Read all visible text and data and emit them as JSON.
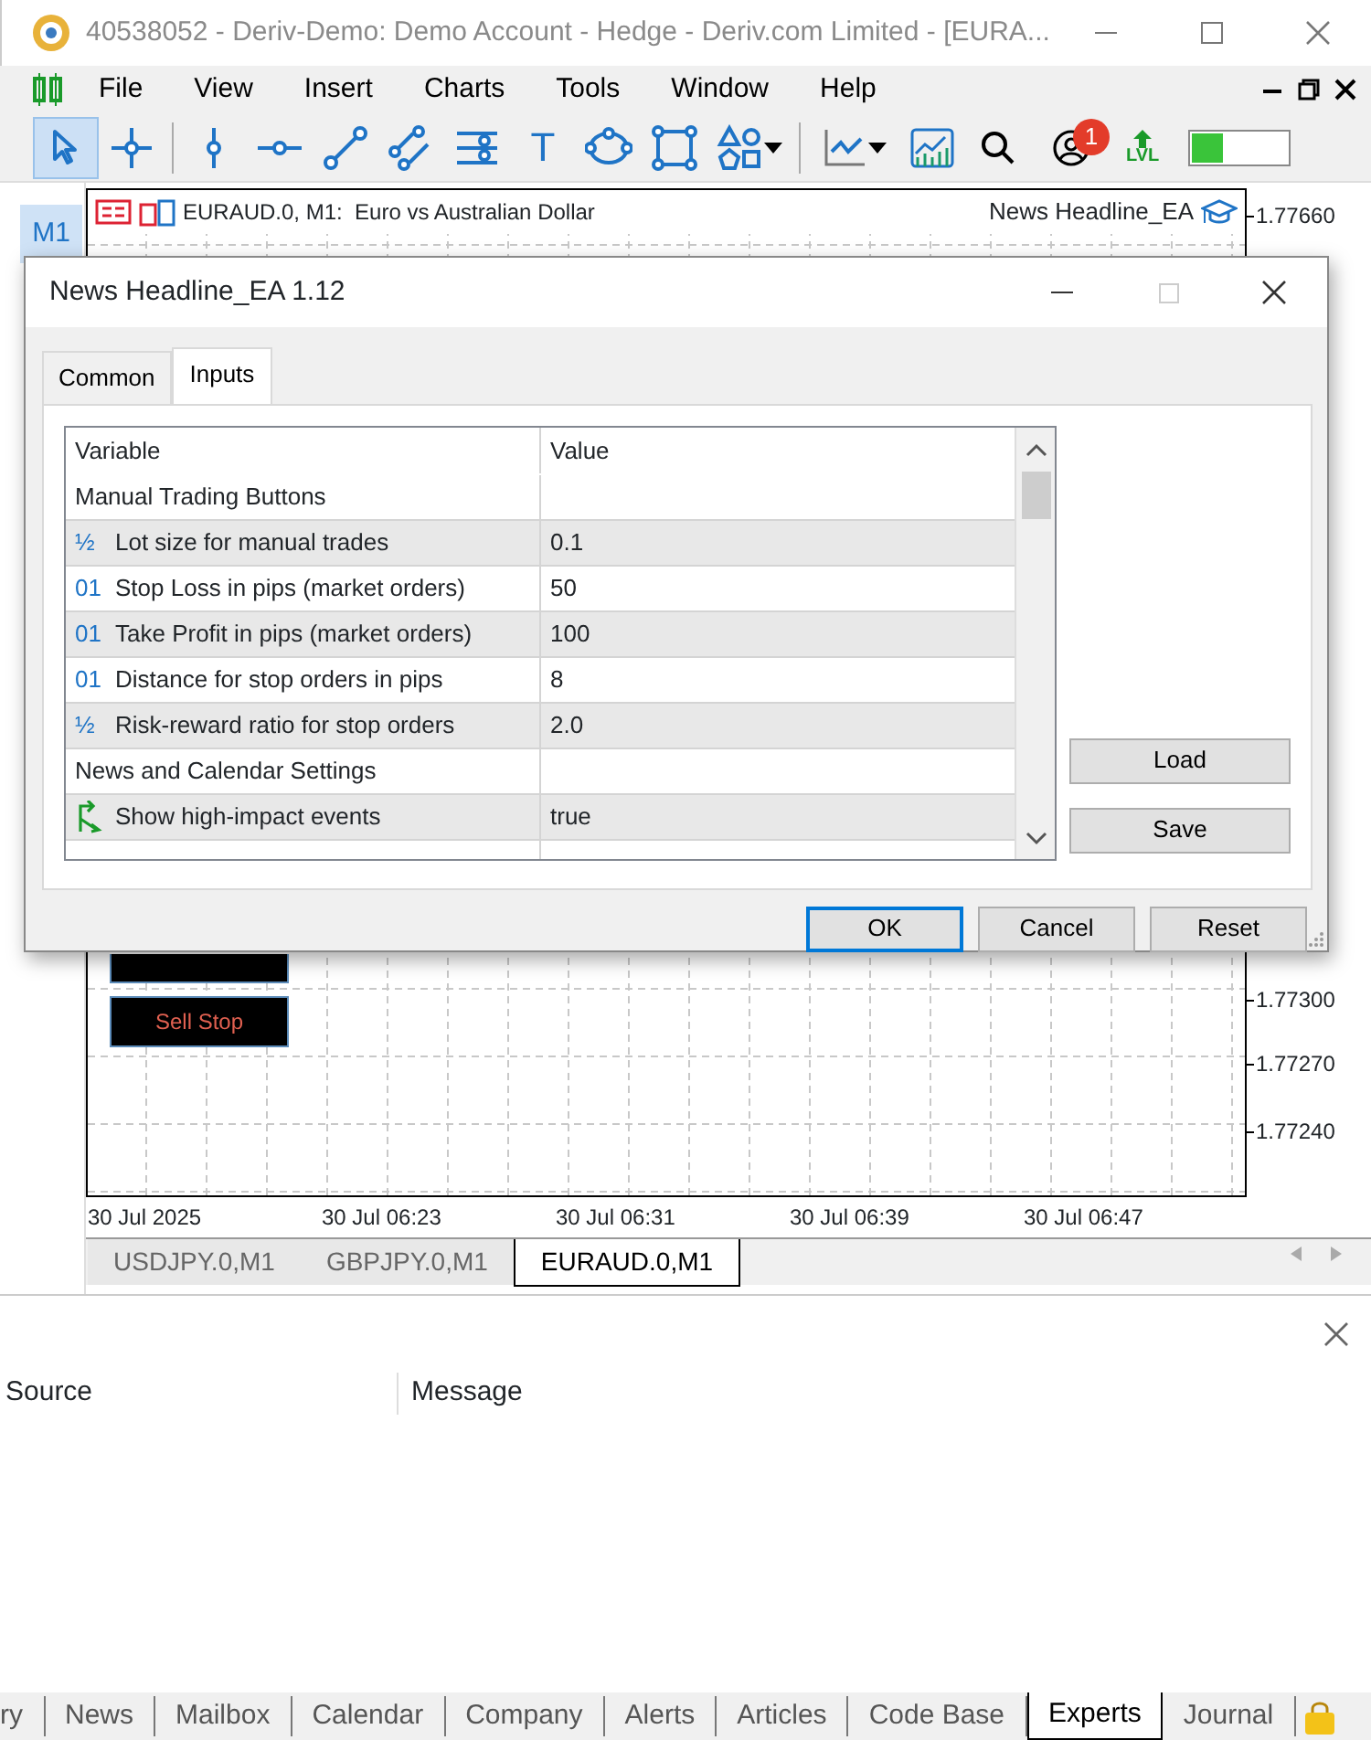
{
  "window": {
    "title": "40538052 - Deriv-Demo: Demo Account - Hedge - Deriv.com Limited - [EURA..."
  },
  "menu": [
    {
      "label": "File"
    },
    {
      "label": "View"
    },
    {
      "label": "Insert"
    },
    {
      "label": "Charts"
    },
    {
      "label": "Tools"
    },
    {
      "label": "Window"
    },
    {
      "label": "Help"
    }
  ],
  "toolbar": {
    "tools": [
      {
        "kind": "cursor",
        "selected": true
      },
      {
        "kind": "crosshair",
        "selected": false
      },
      {
        "kind": "vline",
        "selected": false
      },
      {
        "kind": "hline",
        "selected": false
      },
      {
        "kind": "trend",
        "selected": false
      },
      {
        "kind": "channel",
        "selected": false
      },
      {
        "kind": "fibo",
        "selected": false
      },
      {
        "kind": "text",
        "selected": false,
        "label": "T"
      },
      {
        "kind": "ellipse",
        "selected": false
      },
      {
        "kind": "rect",
        "selected": false
      },
      {
        "kind": "shapes",
        "selected": false
      }
    ],
    "notification_count": "1",
    "lvl_label": "LVL",
    "meter": {
      "level": 0.33
    }
  },
  "timeframe_button": "M1",
  "chart": {
    "header": "EURAUD.0, M1:  Euro vs Australian Dollar",
    "expert": "News Headline_EA",
    "price_labels": [
      "1.77660",
      "1.77300",
      "1.77270",
      "1.77240"
    ],
    "time_labels": [
      "30 Jul 2025",
      "30 Jul 06:23",
      "30 Jul 06:31",
      "30 Jul 06:39",
      "30 Jul 06:47"
    ],
    "sell_stop_button": "Sell Stop"
  },
  "chart_tabs": [
    {
      "label": "USDJPY.0,M1",
      "selected": false
    },
    {
      "label": "GBPJPY.0,M1",
      "selected": false
    },
    {
      "label": "EURAUD.0,M1",
      "selected": true
    }
  ],
  "dialog": {
    "title": "News Headline_EA 1.12",
    "tabs": [
      {
        "label": "Common",
        "selected": false
      },
      {
        "label": "Inputs",
        "selected": true
      }
    ],
    "columns": [
      "Variable",
      "Value"
    ],
    "rows": [
      {
        "kind": "group",
        "variable": "Manual Trading Buttons"
      },
      {
        "kind": "double",
        "type_mark": "½",
        "variable": "Lot size for manual trades",
        "value": "0.1"
      },
      {
        "kind": "integer",
        "type_mark": "01",
        "variable": "Stop Loss in pips (market orders)",
        "value": "50"
      },
      {
        "kind": "integer",
        "type_mark": "01",
        "variable": "Take Profit in pips (market orders)",
        "value": "100"
      },
      {
        "kind": "integer",
        "type_mark": "01",
        "variable": "Distance for stop orders in pips",
        "value": "8"
      },
      {
        "kind": "double",
        "type_mark": "½",
        "variable": "Risk-reward ratio for stop orders",
        "value": "2.0"
      },
      {
        "kind": "group",
        "variable": "News and Calendar Settings"
      },
      {
        "kind": "bool",
        "variable": "Show high-impact events",
        "value": "true"
      }
    ],
    "side_buttons": [
      "Load",
      "Save"
    ],
    "buttons": [
      {
        "label": "OK",
        "default": true
      },
      {
        "label": "Cancel",
        "default": false
      },
      {
        "label": "Reset",
        "default": false
      }
    ]
  },
  "toolbox": {
    "columns": [
      "Source",
      "Message"
    ],
    "tabs": [
      {
        "label": "ry",
        "selected": false
      },
      {
        "label": "News",
        "selected": false
      },
      {
        "label": "Mailbox",
        "selected": false
      },
      {
        "label": "Calendar",
        "selected": false
      },
      {
        "label": "Company",
        "selected": false
      },
      {
        "label": "Alerts",
        "selected": false
      },
      {
        "label": "Articles",
        "selected": false
      },
      {
        "label": "Code Base",
        "selected": false
      },
      {
        "label": "Experts",
        "selected": true
      },
      {
        "label": "Journal",
        "selected": false
      }
    ]
  }
}
